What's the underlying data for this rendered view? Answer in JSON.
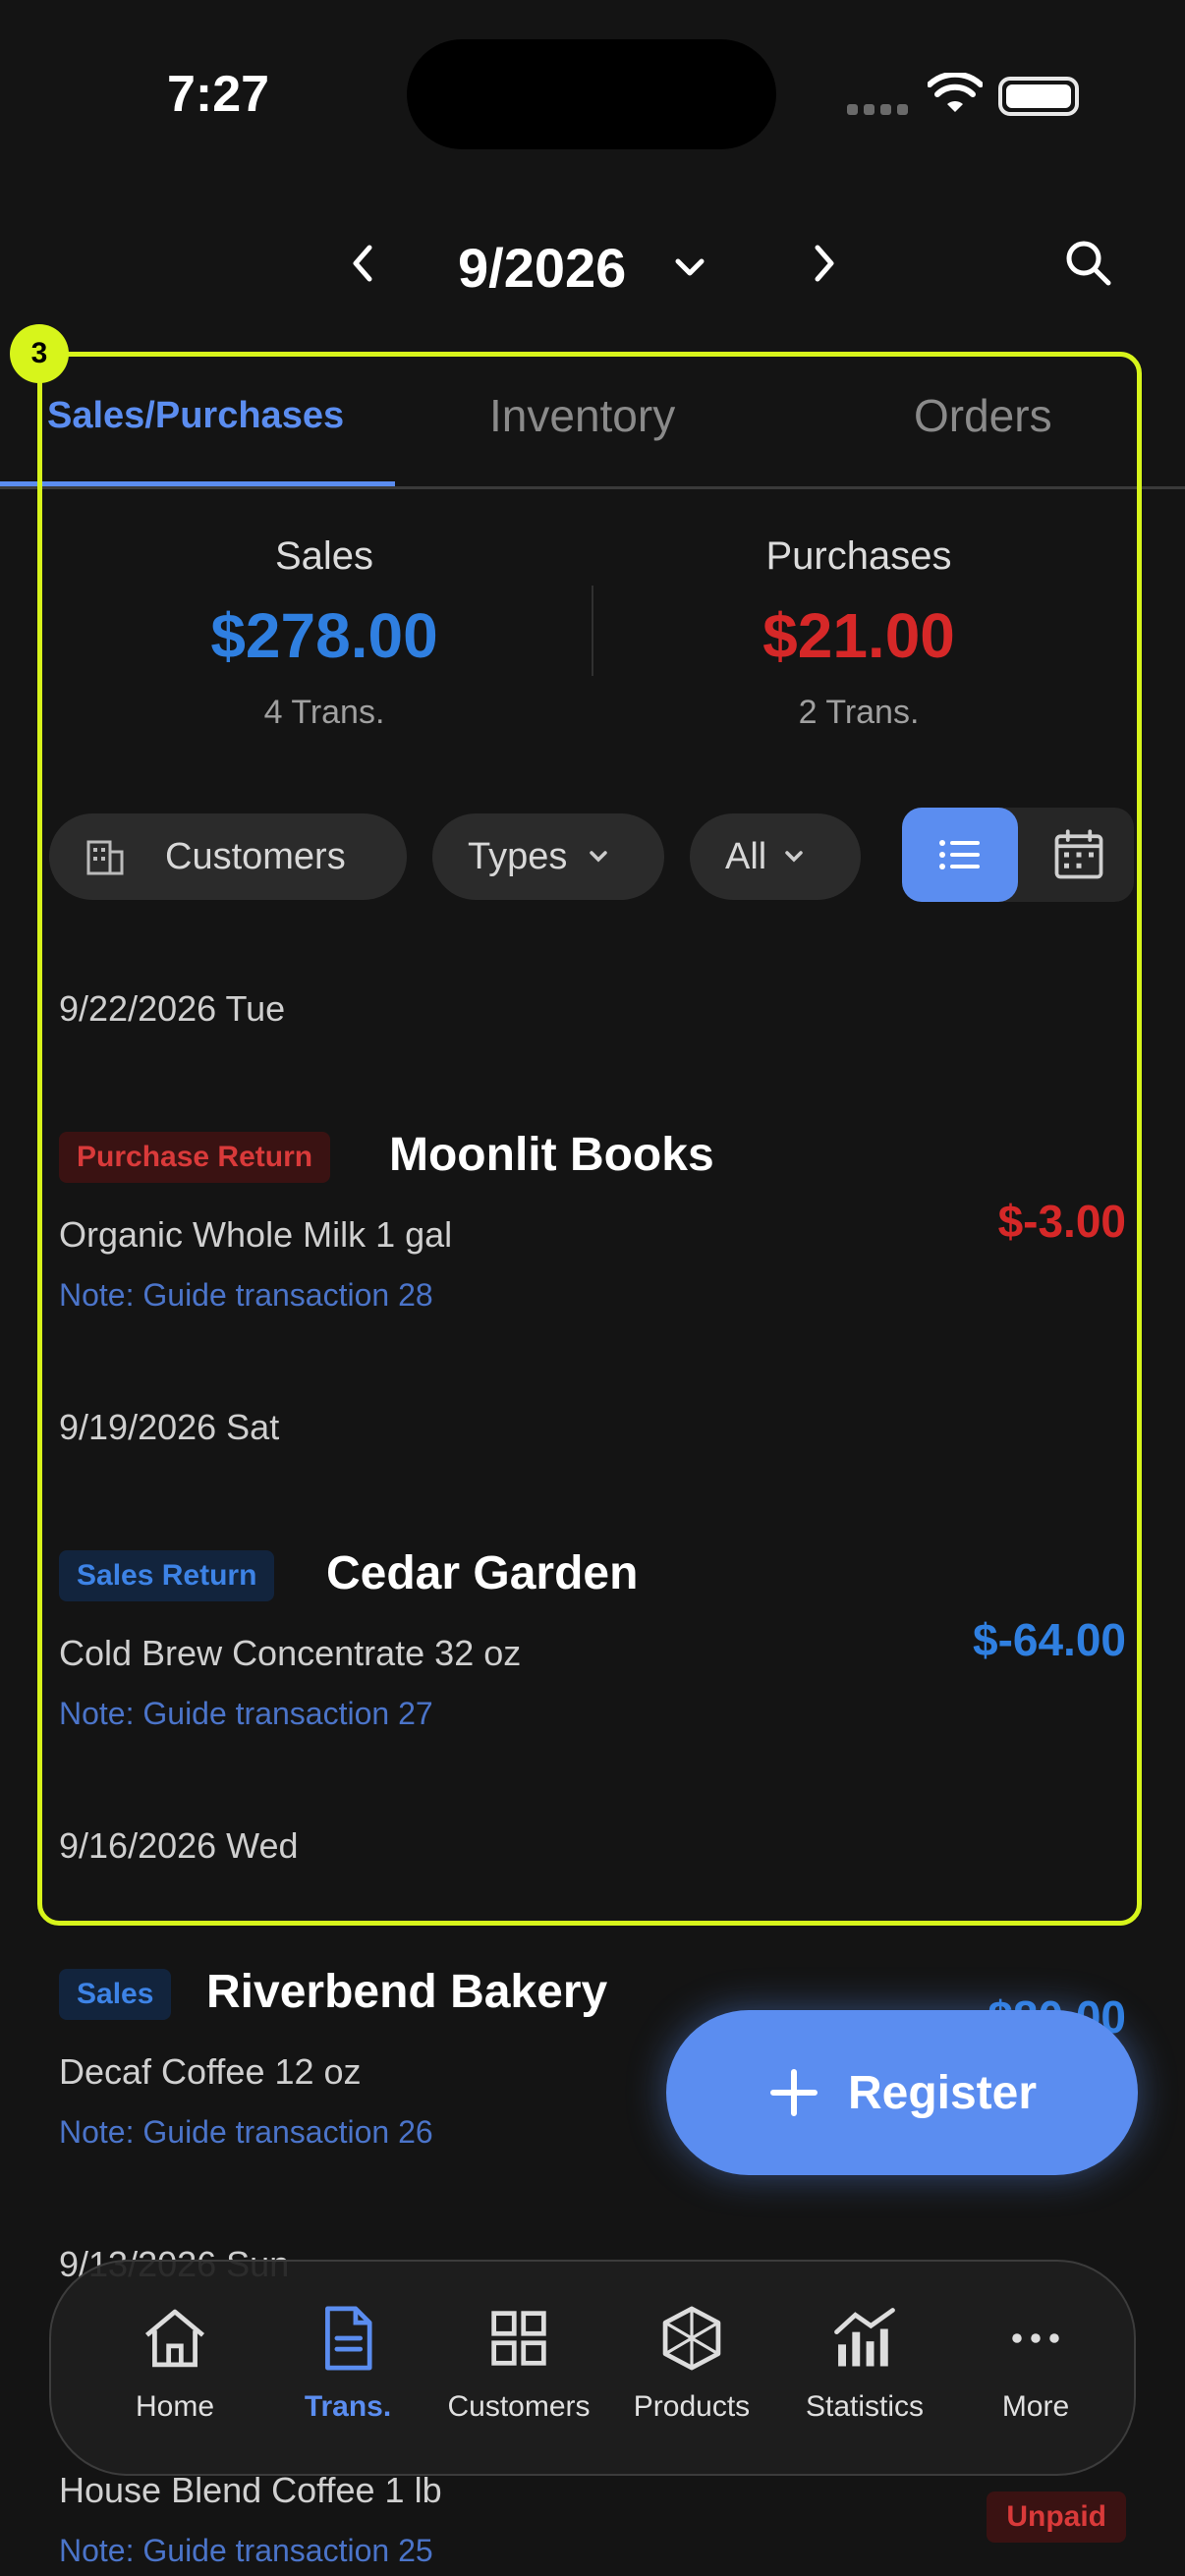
{
  "status_bar": {
    "time": "7:27"
  },
  "header": {
    "month": "9/2026"
  },
  "highlight": {
    "badge": "3"
  },
  "tabs": [
    {
      "label": "Sales/Purchases",
      "active": true
    },
    {
      "label": "Inventory",
      "active": false
    },
    {
      "label": "Orders",
      "active": false
    }
  ],
  "summary": {
    "sales": {
      "label": "Sales",
      "amount": "$278.00",
      "trans": "4 Trans."
    },
    "purchases": {
      "label": "Purchases",
      "amount": "$21.00",
      "trans": "2 Trans."
    }
  },
  "filters": {
    "customers": "Customers",
    "types": "Types",
    "all": "All"
  },
  "transactions": [
    {
      "date": "9/22/2026 Tue",
      "type": "Purchase Return",
      "party": "Moonlit Books",
      "item": "Organic Whole Milk 1 gal",
      "note": "Note: Guide transaction 28",
      "amount": "$-3.00"
    },
    {
      "date": "9/19/2026 Sat",
      "type": "Sales Return",
      "party": "Cedar Garden",
      "item": "Cold Brew Concentrate 32 oz",
      "note": "Note: Guide transaction 27",
      "amount": "$-64.00"
    },
    {
      "date": "9/16/2026 Wed",
      "type": "Sales",
      "party": "Riverbend Bakery",
      "item": "Decaf Coffee 12 oz",
      "note": "Note: Guide transaction 26",
      "amount": "$80.00"
    },
    {
      "date": "9/13/2026 Sun",
      "item": "House Blend Coffee 1 lb",
      "note": "Note: Guide transaction 25",
      "status": "Unpaid"
    }
  ],
  "fab": {
    "label": "Register"
  },
  "tabbar": [
    {
      "label": "Home",
      "icon": "home-icon"
    },
    {
      "label": "Trans.",
      "icon": "document-icon",
      "active": true
    },
    {
      "label": "Customers",
      "icon": "grid-icon"
    },
    {
      "label": "Products",
      "icon": "cube-icon"
    },
    {
      "label": "Statistics",
      "icon": "chart-icon"
    },
    {
      "label": "More",
      "icon": "more-icon"
    }
  ],
  "colors": {
    "accent": "#5b8df0",
    "sales": "#2f7fe0",
    "purchase": "#d62828",
    "highlight": "#d7f51b"
  }
}
